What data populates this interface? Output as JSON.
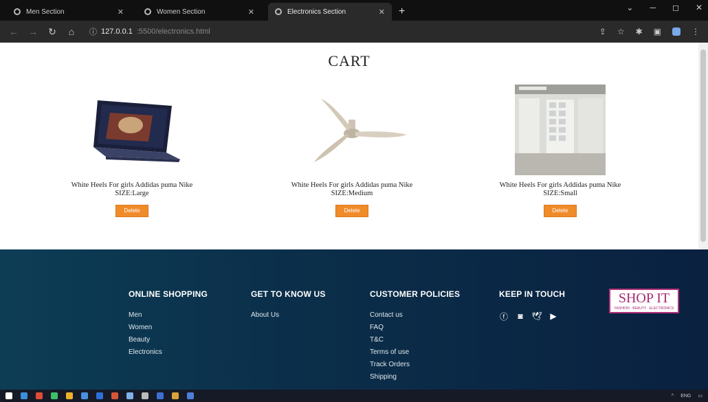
{
  "browser": {
    "tabs": [
      {
        "label": "Men Section",
        "active": false
      },
      {
        "label": "Women Section",
        "active": false
      },
      {
        "label": "Electronics Section",
        "active": true
      }
    ],
    "new_tab": "+",
    "url_host": "127.0.0.1",
    "url_path": ":5500/electronics.html",
    "minimize": "─",
    "maximize": "◻",
    "close": "✕"
  },
  "cart": {
    "title": "CART",
    "items": [
      {
        "desc": "White Heels For girls Addidas puma Nike",
        "size": "SIZE:Large",
        "delete": "Delete",
        "image": "laptop"
      },
      {
        "desc": "White Heels For girls Addidas puma Nike",
        "size": "SIZE:Medium",
        "delete": "Delete",
        "image": "ceiling-fan"
      },
      {
        "desc": "White Heels For girls Addidas puma Nike",
        "size": "SIZE:Small",
        "delete": "Delete",
        "image": "room"
      }
    ]
  },
  "footer": {
    "online_shopping": {
      "heading": "ONLINE SHOPPING",
      "links": [
        "Men",
        "Women",
        "Beauty",
        "Electronics"
      ]
    },
    "get_to_know": {
      "heading": "GET TO KNOW US",
      "links": [
        "About Us"
      ]
    },
    "customer_policies": {
      "heading": "CUSTOMER POLICIES",
      "links": [
        "Contact us",
        "FAQ",
        "T&C",
        "Terms of use",
        "Track Orders",
        "Shipping"
      ]
    },
    "keep_in_touch": {
      "heading": "KEEP IN TOUCH",
      "icons": [
        "facebook-icon",
        "instagram-icon",
        "twitter-icon",
        "youtube-icon"
      ]
    },
    "logo_text": "SHOP IT",
    "logo_sub": "FASHION · BEAUTY · ELECTRONICS"
  },
  "taskbar": {
    "lang": "ENG"
  },
  "colors": {
    "delete_button": "#f08b2a",
    "footer_bg": "#0b2f4a",
    "logo": "#a62a6f"
  }
}
